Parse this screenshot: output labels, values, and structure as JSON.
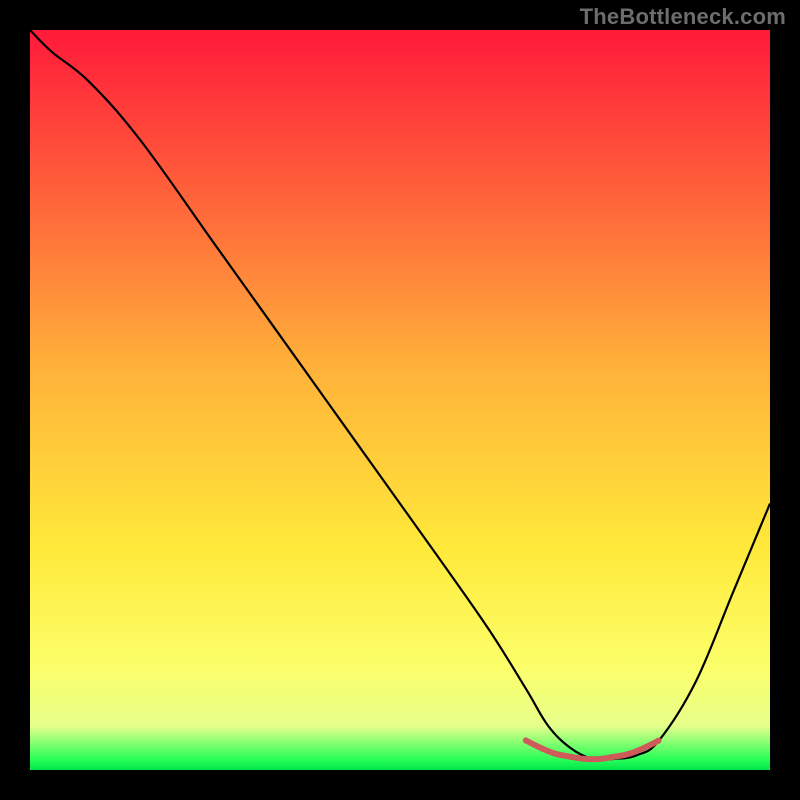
{
  "watermark": "TheBottleneck.com",
  "chart_data": {
    "type": "line",
    "title": "",
    "xlabel": "",
    "ylabel": "",
    "xlim": [
      0,
      100
    ],
    "ylim": [
      0,
      100
    ],
    "grid": false,
    "legend": false,
    "gradient_stops": [
      {
        "offset": 0.0,
        "color": "#ff1a3a"
      },
      {
        "offset": 0.2,
        "color": "#ff5a3a"
      },
      {
        "offset": 0.45,
        "color": "#ffb03a"
      },
      {
        "offset": 0.7,
        "color": "#ffe93a"
      },
      {
        "offset": 0.86,
        "color": "#fcff6a"
      },
      {
        "offset": 0.94,
        "color": "#e6ff8a"
      },
      {
        "offset": 0.985,
        "color": "#2bff5a"
      },
      {
        "offset": 1.0,
        "color": "#00e54a"
      }
    ],
    "series": [
      {
        "name": "bottleneck-curve",
        "stroke": "#000000",
        "stroke_width": 2.2,
        "x": [
          0,
          3,
          8,
          15,
          25,
          35,
          45,
          55,
          62,
          67,
          70,
          73,
          76,
          79,
          82,
          85,
          90,
          95,
          100
        ],
        "y": [
          100,
          97,
          93,
          85,
          71,
          57,
          43,
          29,
          19,
          11,
          6,
          3,
          1.5,
          1.5,
          2,
          4,
          12,
          24,
          36
        ]
      },
      {
        "name": "optimal-marker",
        "stroke": "#cf5a5a",
        "stroke_width": 6,
        "dashed": true,
        "x": [
          67,
          69,
          71,
          73,
          75,
          77,
          79,
          81,
          83,
          85
        ],
        "y": [
          4,
          3,
          2.2,
          1.8,
          1.5,
          1.5,
          1.8,
          2.2,
          3,
          4
        ]
      }
    ]
  }
}
